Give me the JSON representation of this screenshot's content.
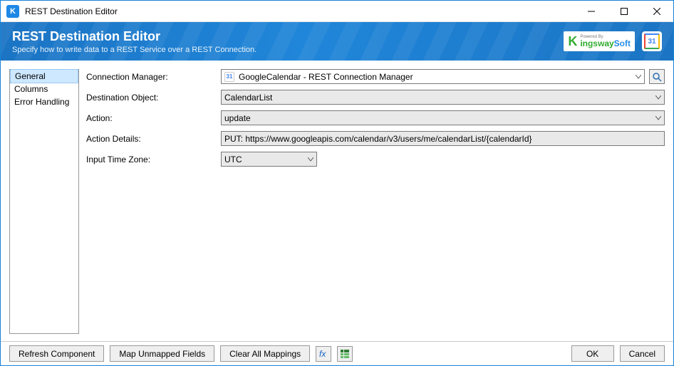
{
  "window": {
    "title": "REST Destination Editor"
  },
  "banner": {
    "heading": "REST Destination Editor",
    "subhead": "Specify how to write data to a REST Service over a REST Connection.",
    "powered_by": "Powered By",
    "brand": "KingswaySoft",
    "gc_day": "31"
  },
  "sidebar": {
    "items": [
      "General",
      "Columns",
      "Error Handling"
    ],
    "selected": 0
  },
  "form": {
    "connection_label": "Connection Manager:",
    "connection_value": "GoogleCalendar - REST Connection Manager",
    "dest_label": "Destination Object:",
    "dest_value": "CalendarList",
    "action_label": "Action:",
    "action_value": "update",
    "details_label": "Action Details:",
    "details_value": "PUT: https://www.googleapis.com/calendar/v3/users/me/calendarList/{calendarId}",
    "tz_label": "Input Time Zone:",
    "tz_value": "UTC"
  },
  "footer": {
    "refresh": "Refresh Component",
    "map": "Map Unmapped Fields",
    "clear": "Clear All Mappings",
    "ok": "OK",
    "cancel": "Cancel"
  }
}
